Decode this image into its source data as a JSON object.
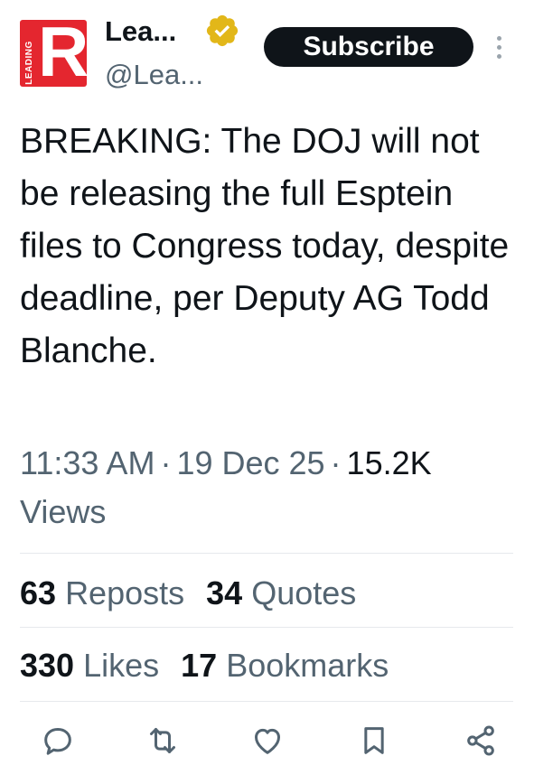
{
  "author": {
    "avatar_letter": "R",
    "avatar_side_text": "LEADING",
    "name": "Lea...",
    "handle": "@Lea...",
    "verified": true,
    "badge_color": "#e2b719"
  },
  "header": {
    "subscribe_label": "Subscribe"
  },
  "tweet": {
    "text": "BREAKING: The DOJ will not be releasing the full Esptein files to Congress today, despite deadline, per Deputy AG Todd Blanche."
  },
  "meta": {
    "time": "11:33 AM",
    "date": "19 Dec 25",
    "separator": "·",
    "views_count": "15.2K",
    "views_label": "Views"
  },
  "stats": {
    "reposts_count": "63",
    "reposts_label": "Reposts",
    "quotes_count": "34",
    "quotes_label": "Quotes",
    "likes_count": "330",
    "likes_label": "Likes",
    "bookmarks_count": "17",
    "bookmarks_label": "Bookmarks"
  },
  "actions": [
    {
      "icon": "reply-icon"
    },
    {
      "icon": "repost-icon"
    },
    {
      "icon": "like-icon"
    },
    {
      "icon": "bookmark-icon"
    },
    {
      "icon": "share-icon"
    }
  ],
  "colors": {
    "text": "#0f1419",
    "secondary": "#536471",
    "brand_red": "#e4262f",
    "subscribe_bg": "#0f1419"
  }
}
